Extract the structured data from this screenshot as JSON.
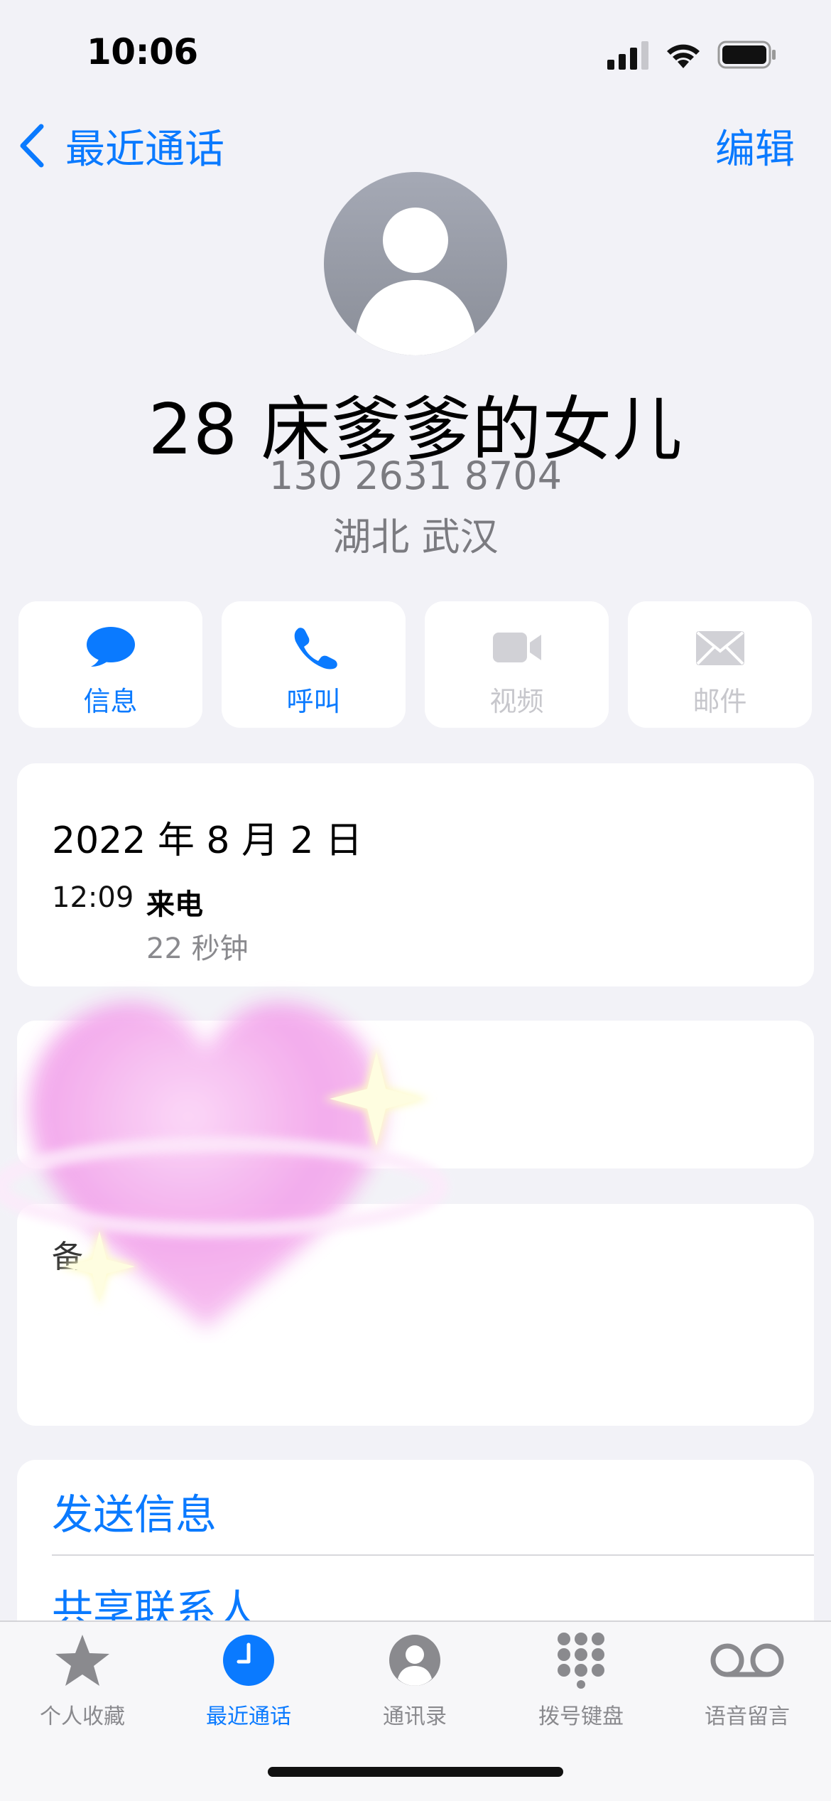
{
  "status_bar": {
    "time": "10:06"
  },
  "nav": {
    "back_label": "最近通话",
    "edit_label": "编辑"
  },
  "contact": {
    "name": "28 床爹爹的女儿",
    "phone": "130 2631 8704",
    "location": "湖北 武汉"
  },
  "actions": [
    {
      "label": "信息",
      "icon": "message-bubble-icon",
      "enabled": true
    },
    {
      "label": "呼叫",
      "icon": "phone-icon",
      "enabled": true
    },
    {
      "label": "视频",
      "icon": "video-camera-icon",
      "enabled": false
    },
    {
      "label": "邮件",
      "icon": "mail-envelope-icon",
      "enabled": false
    }
  ],
  "call_history": {
    "date": "2022 年 8 月 2 日",
    "time": "12:09",
    "type": "来电",
    "duration": "22 秒钟"
  },
  "notes": {
    "label": "备"
  },
  "action_list": [
    {
      "label": "发送信息"
    },
    {
      "label": "共享联系人"
    }
  ],
  "tab_bar": {
    "tabs": [
      {
        "label": "个人收藏",
        "icon": "star-icon",
        "active": false
      },
      {
        "label": "最近通话",
        "icon": "clock-icon",
        "active": true
      },
      {
        "label": "通讯录",
        "icon": "person-circle-icon",
        "active": false
      },
      {
        "label": "拨号键盘",
        "icon": "keypad-icon",
        "active": false
      },
      {
        "label": "语音留言",
        "icon": "voicemail-icon",
        "active": false
      }
    ]
  },
  "colors": {
    "accent": "#0a7aff",
    "background": "#f2f2f7",
    "secondary_text": "#7b7b80",
    "disabled": "#c7c7cc"
  }
}
